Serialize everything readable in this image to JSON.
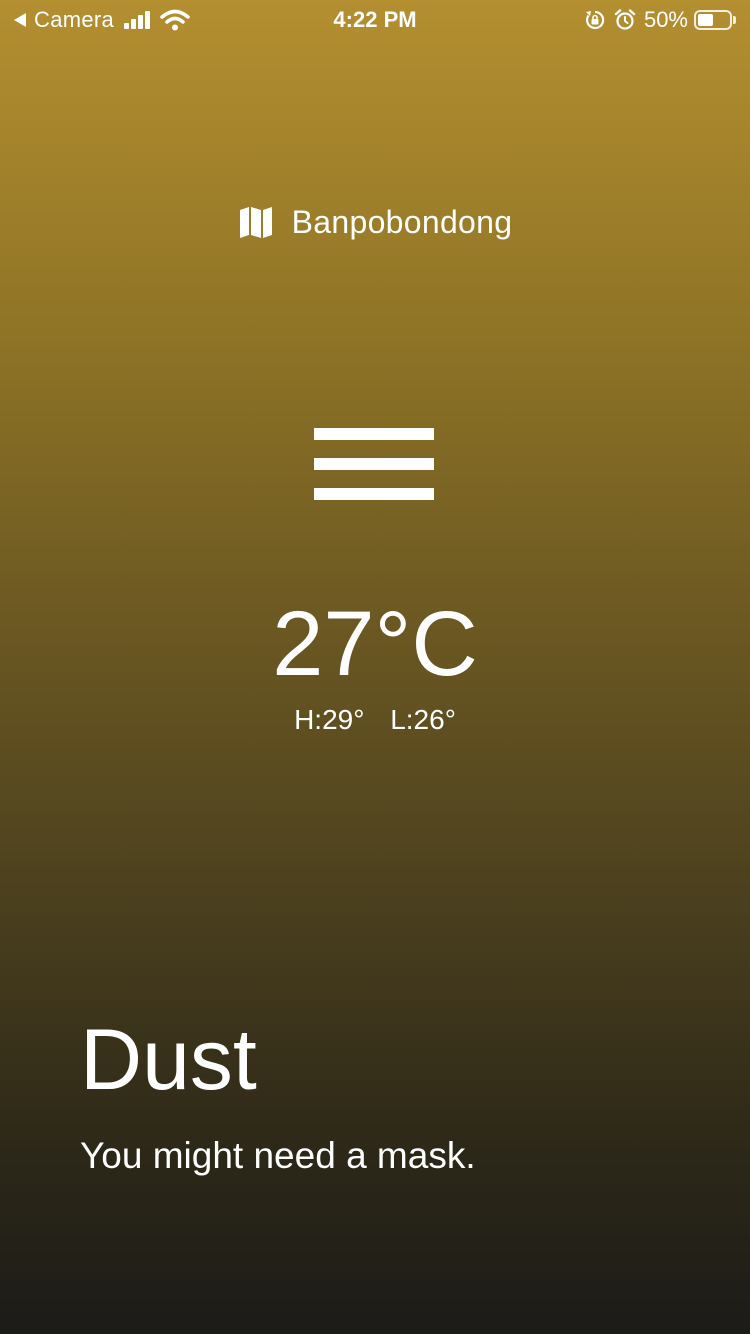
{
  "status_bar": {
    "back_app": "Camera",
    "time": "4:22 PM",
    "battery_percent": "50%",
    "battery_level": 0.5,
    "icons": [
      "back-triangle-icon",
      "signal-icon",
      "wifi-icon",
      "rotation-lock-icon",
      "alarm-icon",
      "battery-icon"
    ]
  },
  "location": {
    "icon": "map-icon",
    "name": "Banpobondong"
  },
  "weather": {
    "icon": "fog-bars-icon",
    "temperature": "27°C",
    "high": "H:29°",
    "low": "L:26°"
  },
  "condition": {
    "title": "Dust",
    "message": "You might need a mask."
  },
  "colors": {
    "gradient_top": "#b48f30",
    "gradient_bottom": "#1c1b18",
    "text": "#ffffff"
  }
}
